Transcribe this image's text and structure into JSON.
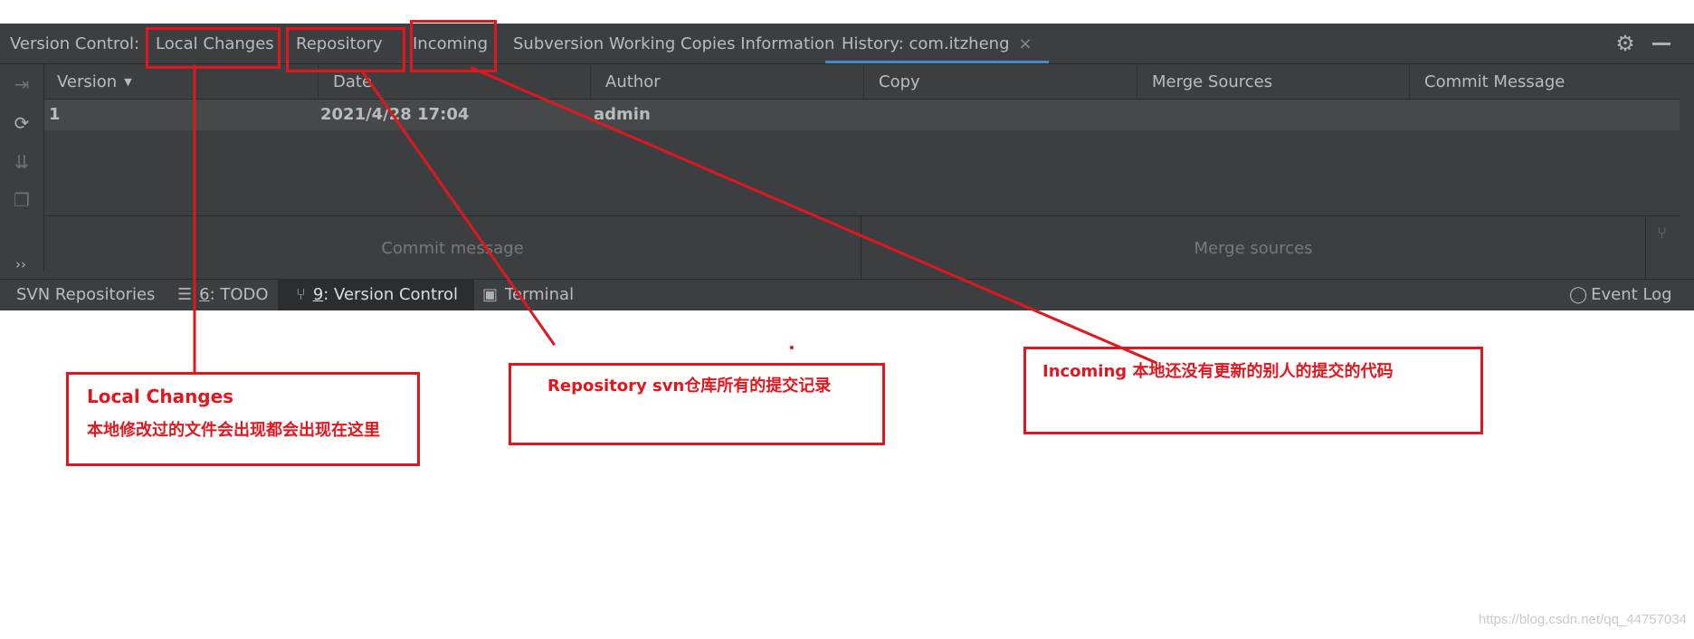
{
  "tabbar": {
    "prefix": "Version Control:",
    "tabs": [
      {
        "label": "Local Changes"
      },
      {
        "label": "Repository"
      },
      {
        "label": "Incoming"
      },
      {
        "label": "Subversion Working Copies Information"
      },
      {
        "label": "History: com.itzheng",
        "closable": true,
        "active": true
      }
    ],
    "close_glyph": "×",
    "settings_icon": "gear-icon",
    "minimize_icon": "minimize-icon"
  },
  "toolbar_icons": [
    "merge-in-icon",
    "refresh-icon",
    "integrate-icon",
    "copy-icon"
  ],
  "table": {
    "columns": [
      "Version",
      "Date",
      "Author",
      "Copy",
      "Merge Sources",
      "Commit Message"
    ],
    "rows": [
      {
        "version": "1",
        "date": "2021/4/28 17:04",
        "author": "admin",
        "copy": "",
        "merge_sources": "",
        "commit_message": ""
      }
    ]
  },
  "details": {
    "commit_placeholder": "Commit message",
    "merge_placeholder": "Merge sources",
    "more": "››"
  },
  "statusbar": {
    "items": [
      {
        "label": "SVN Repositories"
      },
      {
        "num": "6",
        "rest": ": TODO"
      },
      {
        "num": "9",
        "rest": ": Version Control",
        "active": true
      },
      {
        "label": "Terminal"
      }
    ],
    "event_log": "Event Log"
  },
  "annotations": [
    {
      "title": "Local Changes",
      "body": "本地修改过的文件会出现都会出现在这里"
    },
    {
      "title": "Repository svn仓库所有的提交记录"
    },
    {
      "title": "Incoming 本地还没有更新的别人的提交的代码"
    }
  ],
  "watermark": "https://blog.csdn.net/qq_44757034",
  "colors": {
    "annotation_red": "#e0171f",
    "ide_bg": "#3c3f41",
    "accent": "#4a88c7"
  }
}
